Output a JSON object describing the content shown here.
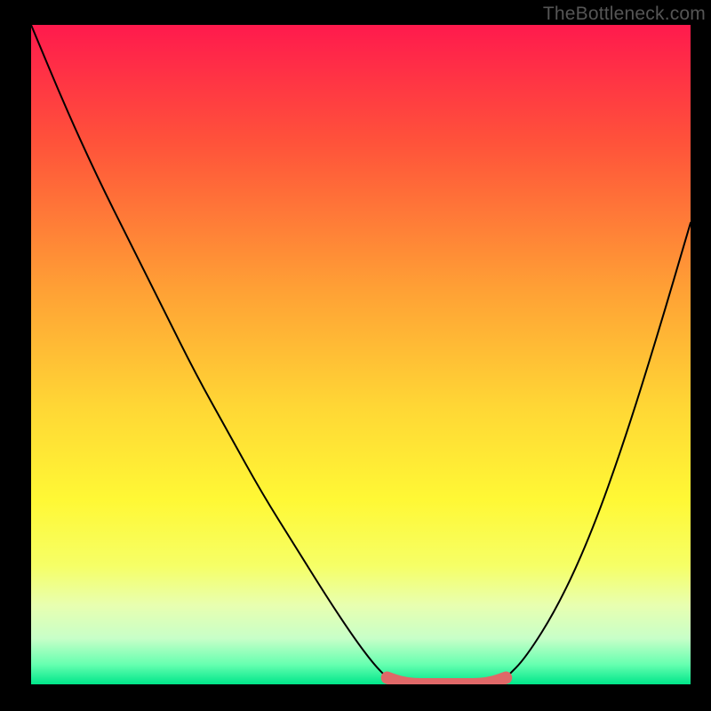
{
  "attribution": "TheBottleneck.com",
  "chart_data": {
    "type": "line",
    "title": "",
    "xlabel": "",
    "ylabel": "",
    "xlim": [
      0,
      1
    ],
    "ylim": [
      0,
      1
    ],
    "background": {
      "type": "vertical-gradient",
      "stops": [
        {
          "offset": 0.0,
          "color": "#ff1a4d"
        },
        {
          "offset": 0.18,
          "color": "#ff533a"
        },
        {
          "offset": 0.4,
          "color": "#ffa035"
        },
        {
          "offset": 0.58,
          "color": "#ffd735"
        },
        {
          "offset": 0.72,
          "color": "#fff835"
        },
        {
          "offset": 0.82,
          "color": "#f6ff66"
        },
        {
          "offset": 0.88,
          "color": "#e8ffb0"
        },
        {
          "offset": 0.93,
          "color": "#c8ffc8"
        },
        {
          "offset": 0.97,
          "color": "#66ffb0"
        },
        {
          "offset": 1.0,
          "color": "#00e68a"
        }
      ]
    },
    "series": [
      {
        "name": "left-curve",
        "color": "#000000",
        "x": [
          0.0,
          0.05,
          0.1,
          0.15,
          0.2,
          0.25,
          0.3,
          0.35,
          0.4,
          0.45,
          0.49,
          0.52,
          0.54
        ],
        "y": [
          1.0,
          0.88,
          0.77,
          0.67,
          0.57,
          0.47,
          0.38,
          0.29,
          0.21,
          0.13,
          0.07,
          0.03,
          0.01
        ]
      },
      {
        "name": "right-curve",
        "color": "#000000",
        "x": [
          0.72,
          0.75,
          0.8,
          0.85,
          0.9,
          0.95,
          1.0
        ],
        "y": [
          0.01,
          0.04,
          0.12,
          0.23,
          0.37,
          0.53,
          0.7
        ]
      },
      {
        "name": "bottom-flat",
        "color": "#e06868",
        "style": "thick-rounded",
        "x": [
          0.54,
          0.56,
          0.58,
          0.6,
          0.62,
          0.64,
          0.66,
          0.68,
          0.7,
          0.72
        ],
        "y": [
          0.01,
          0.003,
          0.0,
          0.0,
          0.0,
          0.0,
          0.0,
          0.0,
          0.003,
          0.01
        ]
      }
    ],
    "markers": [
      {
        "name": "right-marker",
        "x": 0.72,
        "y": 0.01,
        "color": "#e06868",
        "r": 6
      }
    ]
  }
}
